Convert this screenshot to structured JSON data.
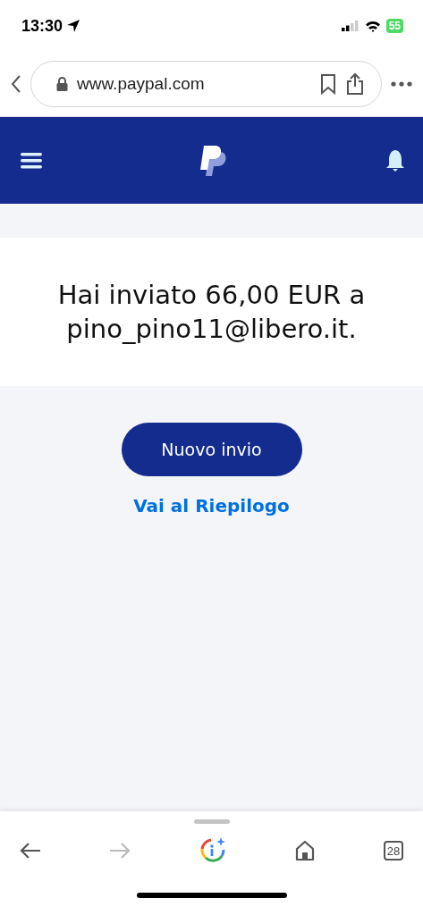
{
  "status_bar": {
    "time": "13:30",
    "battery": "55"
  },
  "browser": {
    "url": "www.paypal.com"
  },
  "message": "Hai inviato 66,00 EUR a pino_pino11@libero.it.",
  "primary_button": "Nuovo invio",
  "summary_link": "Vai al Riepilogo",
  "toolbar": {
    "back_disabled": false,
    "forward_disabled": true,
    "tabs_count": "28"
  }
}
